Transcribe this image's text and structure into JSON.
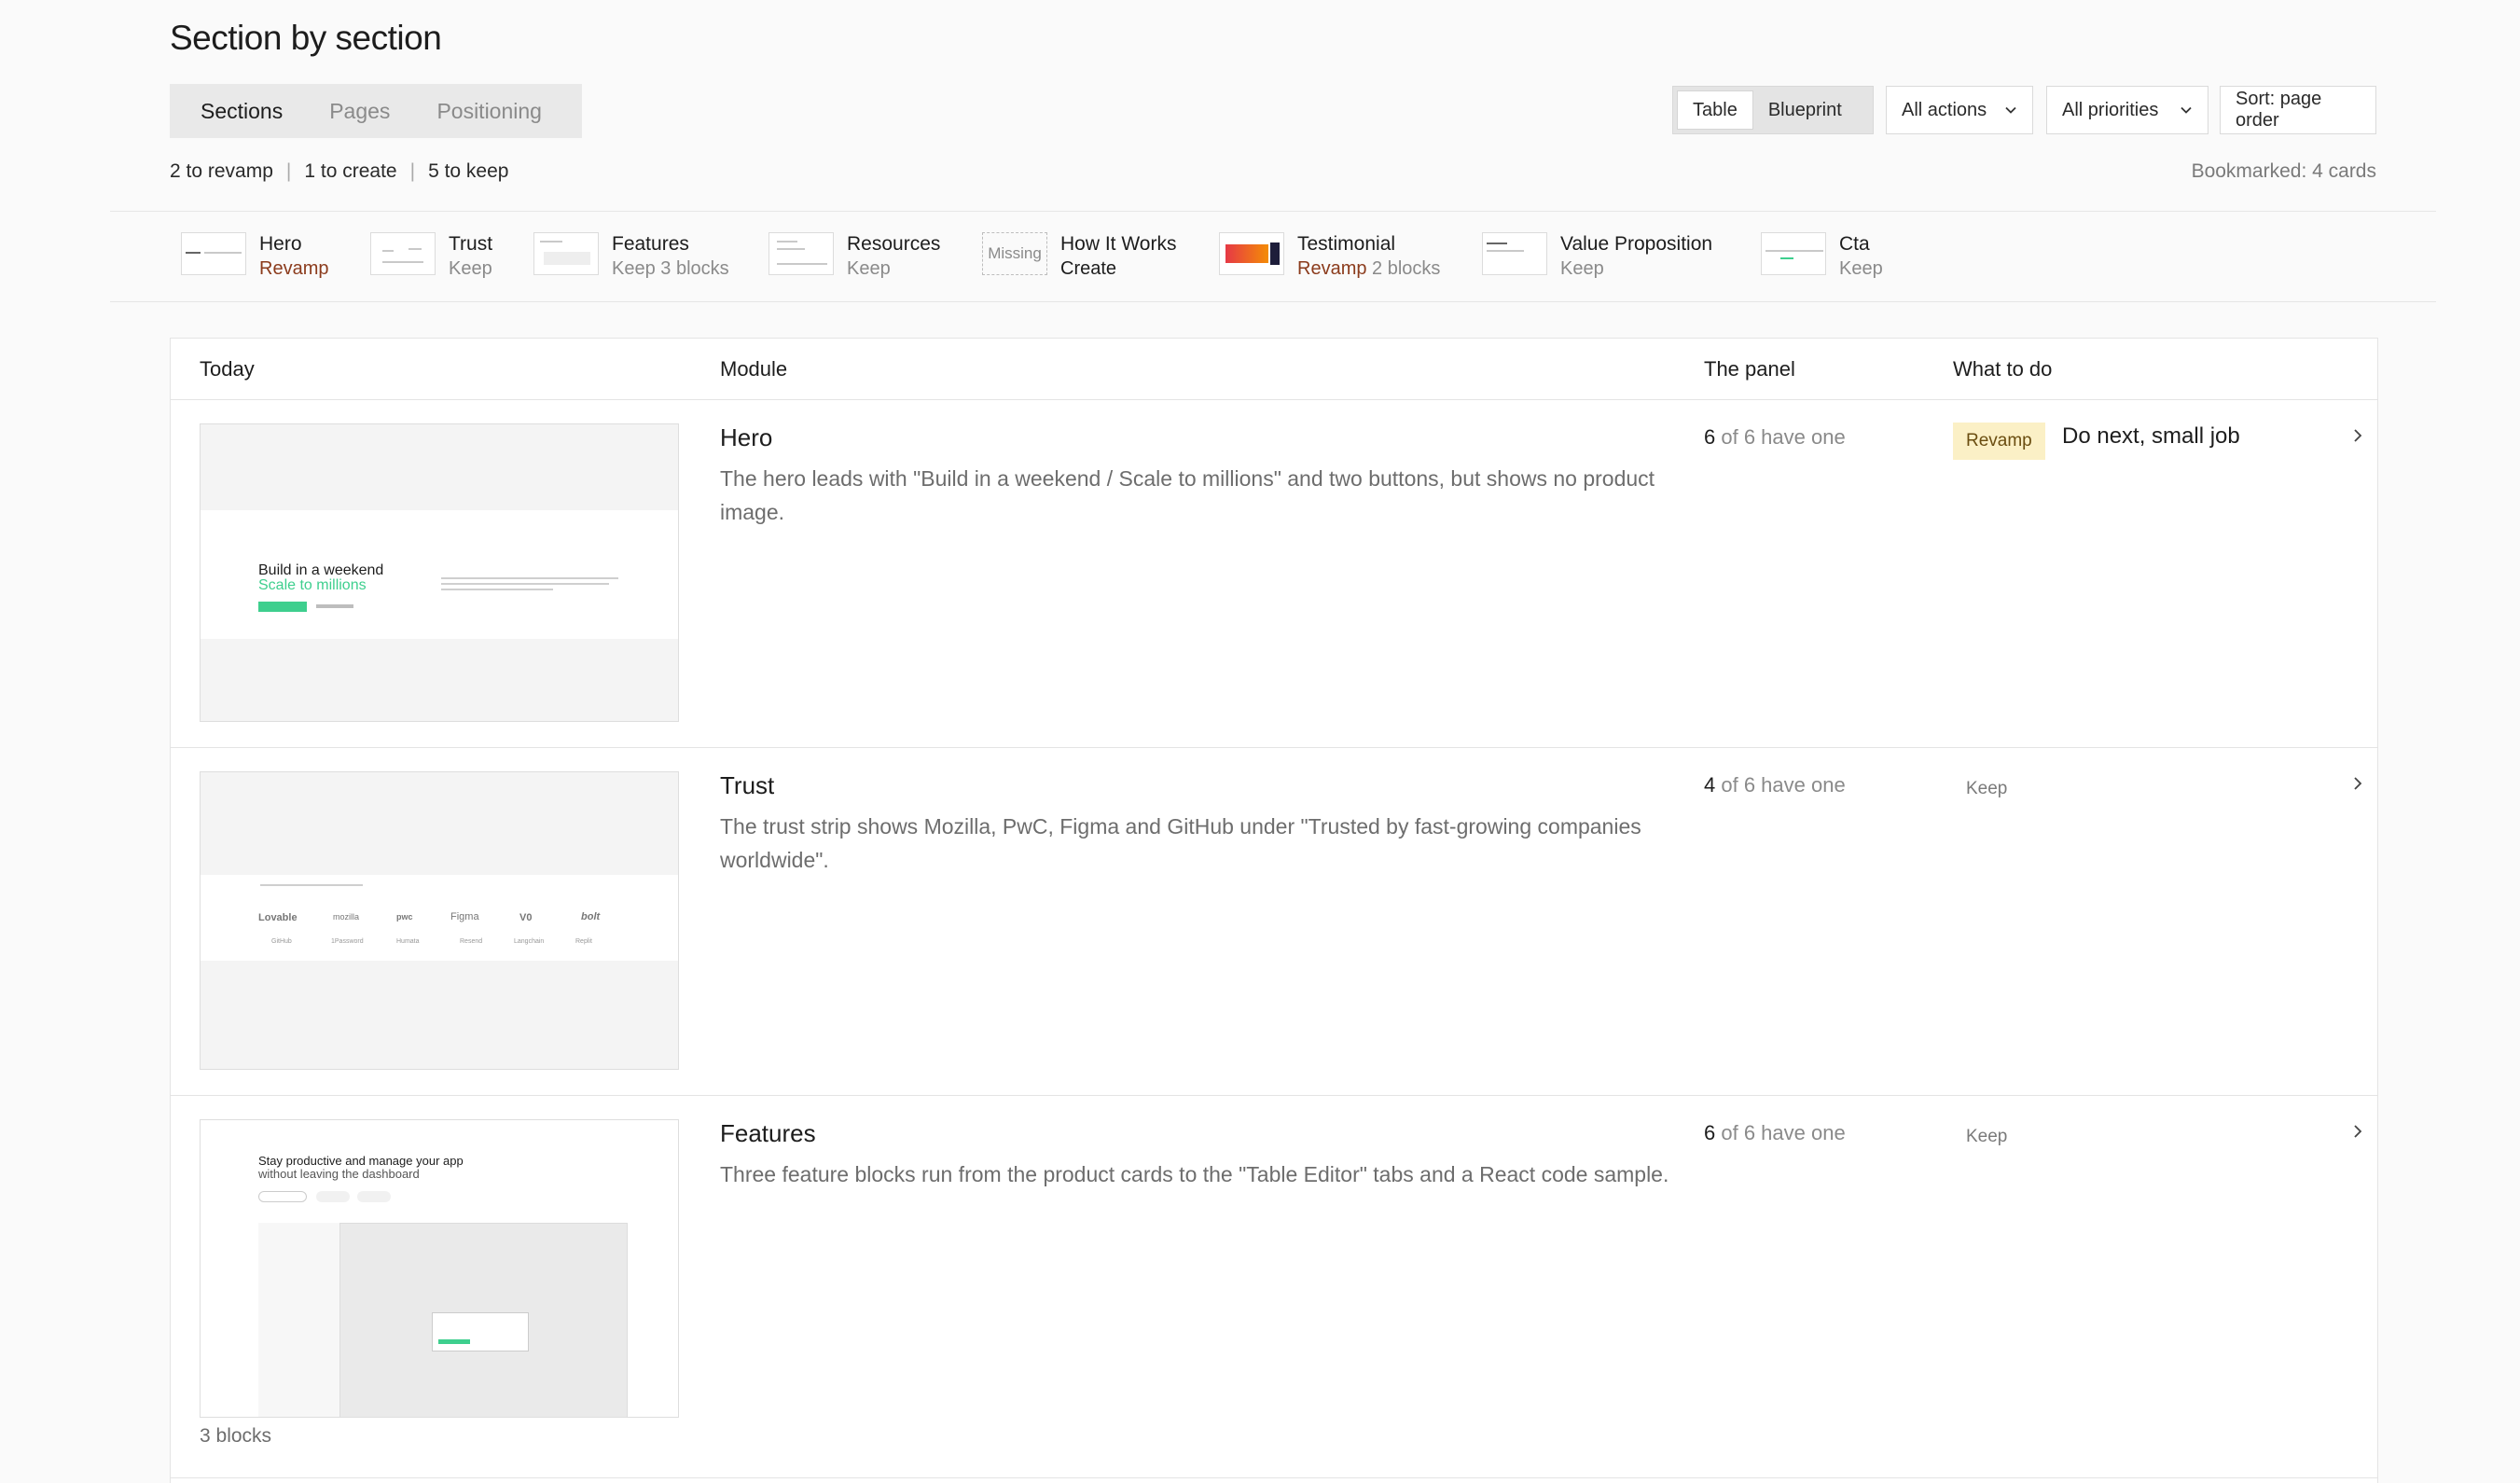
{
  "header": {
    "title": "Section by section",
    "tabs": [
      {
        "label": "Sections",
        "active": true
      },
      {
        "label": "Pages",
        "active": false
      },
      {
        "label": "Positioning",
        "active": false
      }
    ],
    "summary": {
      "revamp": "2 to revamp",
      "create": "1 to create",
      "keep": "5 to keep"
    },
    "bookmarked": "Bookmarked: 4 cards"
  },
  "controls": {
    "view_toggle": {
      "table": "Table",
      "blueprint": "Blueprint",
      "active": "Table"
    },
    "actions_filter": "All actions",
    "priorities_filter": "All priorities",
    "sort": "Sort: page order"
  },
  "strip": [
    {
      "name": "Hero",
      "status": "Revamp",
      "extra": ""
    },
    {
      "name": "Trust",
      "status": "Keep",
      "extra": ""
    },
    {
      "name": "Features",
      "status": "Keep",
      "extra": "3 blocks"
    },
    {
      "name": "Resources",
      "status": "Keep",
      "extra": ""
    },
    {
      "name": "How It Works",
      "status": "Create",
      "extra": "",
      "thumb_label": "Missing"
    },
    {
      "name": "Testimonial",
      "status": "Revamp",
      "extra": "2 blocks"
    },
    {
      "name": "Value Proposition",
      "status": "Keep",
      "extra": ""
    },
    {
      "name": "Cta",
      "status": "Keep",
      "extra": ""
    }
  ],
  "table": {
    "headers": {
      "today": "Today",
      "module": "Module",
      "panel": "The panel",
      "todo": "What to do"
    },
    "rows": [
      {
        "module": "Hero",
        "description": "The hero leads with \"Build in a weekend / Scale to millions\" and two buttons, but shows no product image.",
        "panel_count": "6",
        "panel_suffix": " of 6 have one",
        "action": "Revamp",
        "note": "Do next, small job",
        "thumb": {
          "line1": "Build in a weekend",
          "line2": "Scale to millions"
        }
      },
      {
        "module": "Trust",
        "description": "The trust strip shows Mozilla, PwC, Figma and GitHub under \"Trusted by fast-growing companies worldwide\".",
        "panel_count": "4",
        "panel_suffix": " of 6 have one",
        "action": "Keep",
        "note": "",
        "thumb": {
          "logos_top": [
            "Lovable",
            "mozilla",
            "pwc",
            "Figma",
            "V0",
            "bolt"
          ],
          "logos_bottom": [
            "GitHub",
            "1Password",
            "Humata",
            "Resend",
            "Langchain",
            "Replit"
          ]
        }
      },
      {
        "module": "Features",
        "description": "Three feature blocks run from the product cards to the \"Table Editor\" tabs and a React code sample.",
        "panel_count": "6",
        "panel_suffix": " of 6 have one",
        "action": "Keep",
        "note": "",
        "blocks": "3 blocks",
        "thumb": {
          "line1": "Stay productive and manage your app",
          "line2": "without leaving the dashboard"
        }
      }
    ]
  },
  "colors": {
    "revamp_text": "#8b3b1c",
    "revamp_badge_bg": "#fbf0c6",
    "accent_green": "#3ecf8e"
  }
}
